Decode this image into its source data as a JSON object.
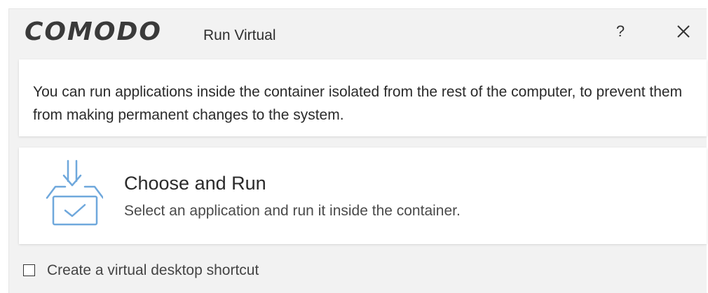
{
  "window": {
    "brand": "COMODO",
    "title": "Run Virtual",
    "help_label": "?"
  },
  "info": {
    "text": "You can run applications inside the container isolated from the rest of the computer, to prevent them from making permanent changes to the system."
  },
  "action": {
    "icon": "install-box-icon",
    "title": "Choose and Run",
    "description": "Select an application and run it inside the container."
  },
  "shortcut": {
    "label": "Create a virtual desktop shortcut",
    "checked": false
  },
  "colors": {
    "background": "#f2f2f2",
    "card": "#ffffff",
    "accent_icon": "#6fa8dc",
    "text": "#2a2a2a"
  }
}
